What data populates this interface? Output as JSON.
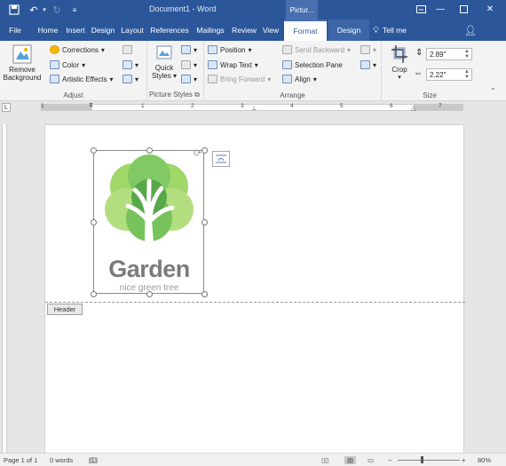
{
  "titlebar": {
    "doc_title": "Document1 - Word",
    "context_label": "Pictur...",
    "save_icon": "save-icon",
    "undo_icon": "undo-icon",
    "redo_icon": "redo-icon",
    "customize_icon": "customize-qat-icon",
    "ribbon_display_icon": "ribbon-display-icon",
    "minimize_icon": "minimize-icon",
    "maximize_icon": "maximize-icon",
    "close_icon": "close-icon"
  },
  "tabs": {
    "file": "File",
    "home": "Home",
    "insert": "Insert",
    "design": "Design",
    "layout": "Layout",
    "references": "References",
    "mailings": "Mailings",
    "review": "Review",
    "view": "View",
    "format": "Format",
    "design2": "Design",
    "tellme": "Tell me"
  },
  "ribbon": {
    "adjust": {
      "label": "Adjust",
      "remove_bg_1": "Remove",
      "remove_bg_2": "Background",
      "corrections": "Corrections",
      "color": "Color",
      "artistic": "Artistic Effects"
    },
    "styles": {
      "label": "Picture Styles",
      "quick_1": "Quick",
      "quick_2": "Styles"
    },
    "arrange": {
      "label": "Arrange",
      "position": "Position",
      "wrap": "Wrap Text",
      "bring_forward": "Bring Forward",
      "send_backward": "Send Backward",
      "selection_pane": "Selection Pane",
      "align": "Align"
    },
    "size": {
      "label": "Size",
      "crop": "Crop",
      "height": "2.89\"",
      "width": "2.22\""
    }
  },
  "ruler": {
    "marks": [
      "1",
      "1",
      "2",
      "3",
      "4",
      "5",
      "6",
      "7"
    ]
  },
  "document": {
    "header_tag": "Header",
    "logo_name": "Garden",
    "logo_tagline": "nice green tree",
    "logo_colors": {
      "light": "#a6d96a",
      "mid": "#6cc04a",
      "dark": "#3a9a2a"
    }
  },
  "status": {
    "page": "Page 1 of 1",
    "words": "0 words",
    "zoom": "80%",
    "zoom_minus": "−",
    "zoom_plus": "+"
  }
}
